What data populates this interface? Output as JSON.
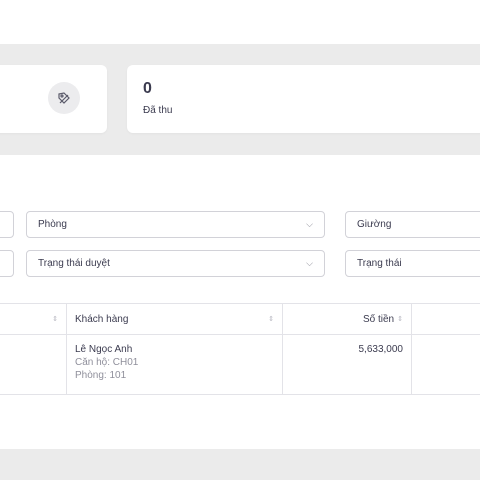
{
  "stats": {
    "paid": {
      "value": "0",
      "label": "Đã thu"
    }
  },
  "filters": {
    "room": "Phòng",
    "bed": "Giường",
    "approval_status": "Trạng thái duyệt",
    "status": "Trạng thái"
  },
  "table": {
    "headers": {
      "customer": "Khách hàng",
      "amount": "Số tiền"
    },
    "rows": [
      {
        "customer_name": "Lê Ngọc Anh",
        "apartment": "Căn hộ: CH01",
        "room": "Phòng: 101",
        "amount": "5,633,000"
      }
    ]
  },
  "icons": {
    "stat_icon": "tag-icon",
    "sort_icon": "sort-icon",
    "dropdown_icon": "chevron-down-icon"
  }
}
